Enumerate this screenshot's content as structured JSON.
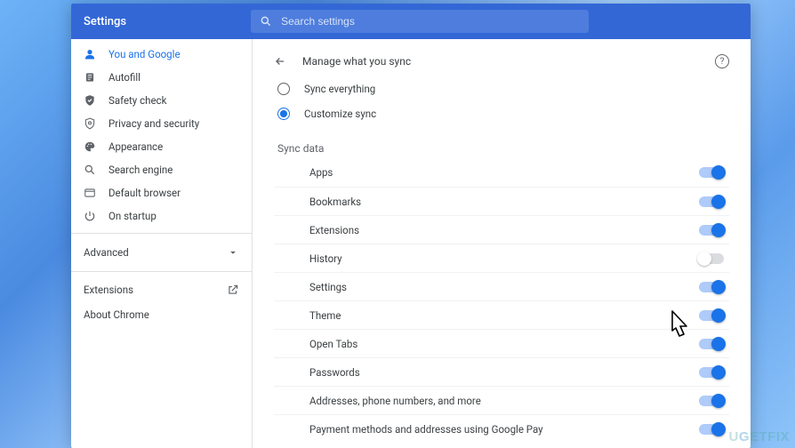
{
  "header": {
    "title": "Settings",
    "search_placeholder": "Search settings"
  },
  "sidebar": {
    "items": [
      {
        "id": "you-and-google",
        "label": "You and Google",
        "icon": "person",
        "selected": true
      },
      {
        "id": "autofill",
        "label": "Autofill",
        "icon": "autofill"
      },
      {
        "id": "safety-check",
        "label": "Safety check",
        "icon": "check-shield"
      },
      {
        "id": "privacy",
        "label": "Privacy and security",
        "icon": "shield"
      },
      {
        "id": "appearance",
        "label": "Appearance",
        "icon": "palette"
      },
      {
        "id": "search-engine",
        "label": "Search engine",
        "icon": "search"
      },
      {
        "id": "default-browser",
        "label": "Default browser",
        "icon": "browser"
      },
      {
        "id": "on-startup",
        "label": "On startup",
        "icon": "power"
      }
    ],
    "advanced_label": "Advanced",
    "extensions_label": "Extensions",
    "about_label": "About Chrome"
  },
  "page": {
    "title": "Manage what you sync",
    "radio_sync_everything": "Sync everything",
    "radio_customize_sync": "Customize sync",
    "selected_radio": "customize",
    "section_label": "Sync data",
    "items": [
      {
        "label": "Apps",
        "on": true
      },
      {
        "label": "Bookmarks",
        "on": true
      },
      {
        "label": "Extensions",
        "on": true
      },
      {
        "label": "History",
        "on": false
      },
      {
        "label": "Settings",
        "on": true
      },
      {
        "label": "Theme",
        "on": true
      },
      {
        "label": "Open Tabs",
        "on": true
      },
      {
        "label": "Passwords",
        "on": true
      },
      {
        "label": "Addresses, phone numbers, and more",
        "on": true
      },
      {
        "label": "Payment methods and addresses using Google Pay",
        "on": true
      }
    ]
  },
  "watermark": "UGETFIX"
}
